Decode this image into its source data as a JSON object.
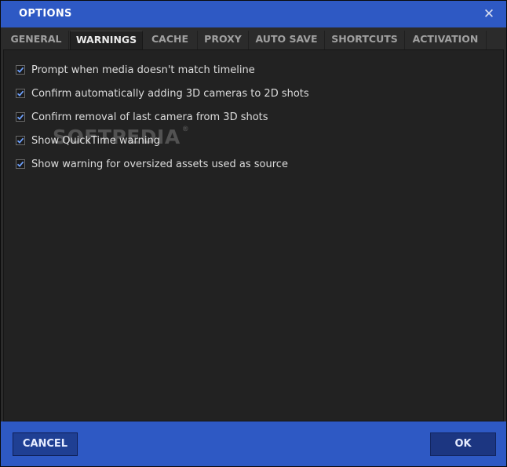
{
  "dialog": {
    "title": "OPTIONS"
  },
  "tabs": [
    {
      "label": "GENERAL"
    },
    {
      "label": "WARNINGS",
      "active": true
    },
    {
      "label": "CACHE"
    },
    {
      "label": "PROXY"
    },
    {
      "label": "AUTO SAVE"
    },
    {
      "label": "SHORTCUTS"
    },
    {
      "label": "ACTIVATION"
    }
  ],
  "warnings": [
    {
      "label": "Prompt when media doesn't match timeline",
      "checked": true
    },
    {
      "label": "Confirm automatically adding 3D cameras to 2D shots",
      "checked": true
    },
    {
      "label": "Confirm removal of last camera from 3D shots",
      "checked": true
    },
    {
      "label": "Show QuickTime warning",
      "checked": true
    },
    {
      "label": "Show warning for oversized assets used as source",
      "checked": true
    }
  ],
  "watermark": "SOFTPEDIA",
  "footer": {
    "cancel_label": "CANCEL",
    "ok_label": "OK"
  },
  "colors": {
    "accent": "#2e59c4",
    "panel": "#222222"
  }
}
